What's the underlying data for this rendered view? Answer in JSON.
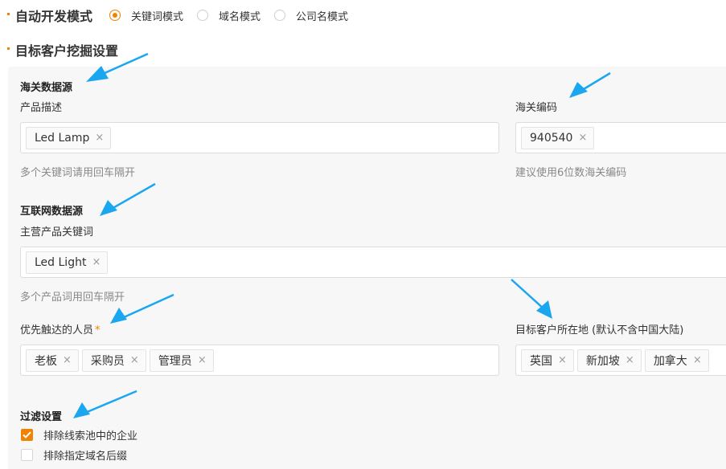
{
  "dev_mode": {
    "title": "自动开发模式",
    "options": [
      {
        "label": "关键词模式",
        "checked": true
      },
      {
        "label": "域名模式",
        "checked": false
      },
      {
        "label": "公司名模式",
        "checked": false
      }
    ]
  },
  "target_settings": {
    "title": "目标客户挖掘设置",
    "customs": {
      "title": "海关数据源",
      "product_desc": {
        "label": "产品描述",
        "tags": [
          "Led Lamp"
        ],
        "hint": "多个关键词请用回车隔开"
      },
      "hs_code": {
        "label": "海关编码",
        "tags": [
          "940540"
        ],
        "hint": "建议使用6位数海关编码"
      }
    },
    "internet": {
      "title": "互联网数据源",
      "main_keywords": {
        "label": "主营产品关键词",
        "tags": [
          "Led Light"
        ],
        "hint": "多个产品词用回车隔开"
      }
    },
    "persons": {
      "label": "优先触达的人员",
      "required_mark": "*",
      "tags": [
        "老板",
        "采购员",
        "管理员"
      ]
    },
    "location": {
      "label": "目标客户所在地 (默认不含中国大陆)",
      "tags": [
        "英国",
        "新加坡",
        "加拿大"
      ]
    },
    "filter": {
      "title": "过滤设置",
      "options": [
        {
          "label": "排除线索池中的企业",
          "checked": true
        },
        {
          "label": "排除指定域名后缀",
          "checked": false
        }
      ]
    }
  },
  "icons": {
    "remove_tag": "×",
    "check": "check-icon",
    "annotation": "arrow-icon"
  },
  "colors": {
    "accent": "#f08200",
    "annotation_arrow": "#1aa7f0",
    "panel_bg": "#f7f7f7"
  }
}
